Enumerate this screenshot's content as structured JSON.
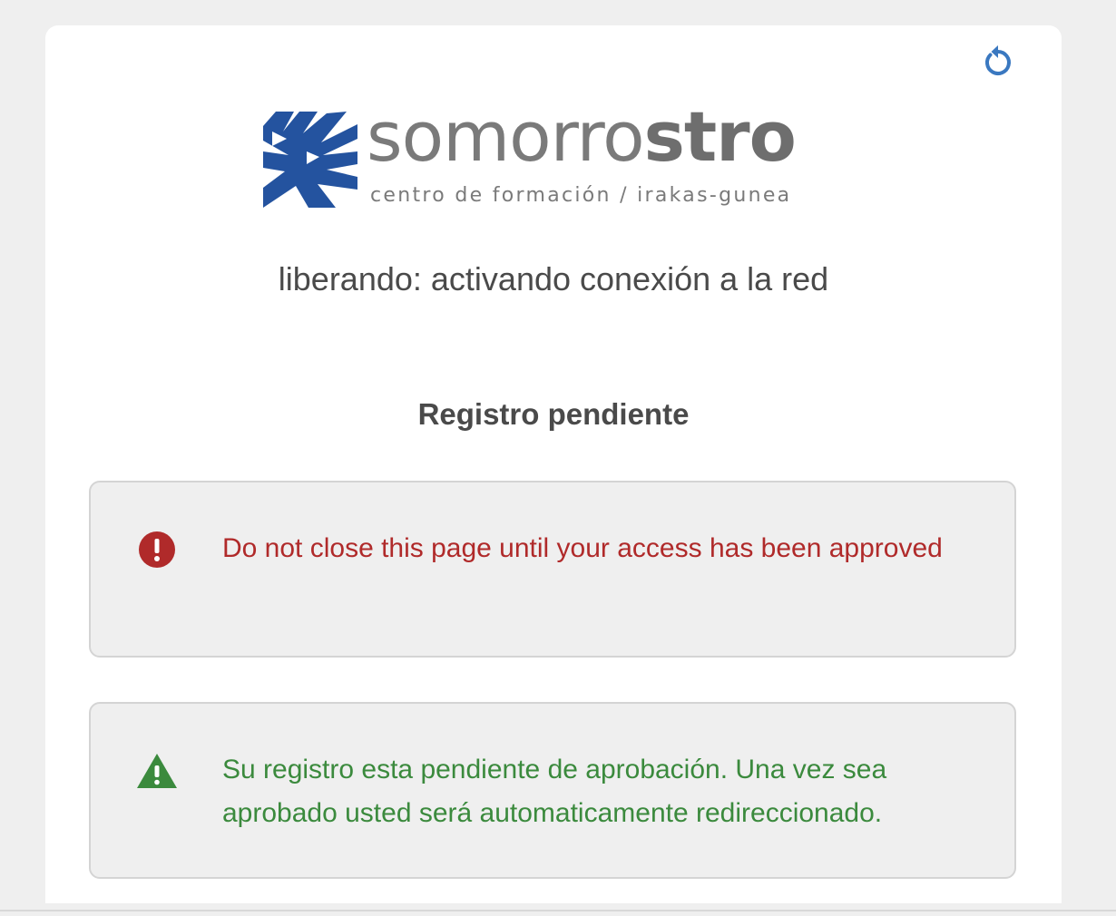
{
  "header": {
    "refresh_icon": "refresh-icon",
    "accent_color": "#3a78c0"
  },
  "logo": {
    "wordmark_regular": "somorro",
    "wordmark_bold": "stro",
    "tagline": "centro de formación / irakas-gunea",
    "mark_color": "#24539f"
  },
  "status": {
    "network_text": "liberando: activando conexión a la red"
  },
  "main": {
    "title": "Registro pendiente",
    "alerts": [
      {
        "type": "danger",
        "icon": "exclamation-circle-icon",
        "color": "#b02a2a",
        "text": "Do not close this page until your access has been approved"
      },
      {
        "type": "success",
        "icon": "warning-triangle-icon",
        "color": "#3b8a3d",
        "text": "Su registro esta pendiente de aprobación. Una vez sea aprobado usted será automaticamente redireccionado."
      }
    ]
  }
}
